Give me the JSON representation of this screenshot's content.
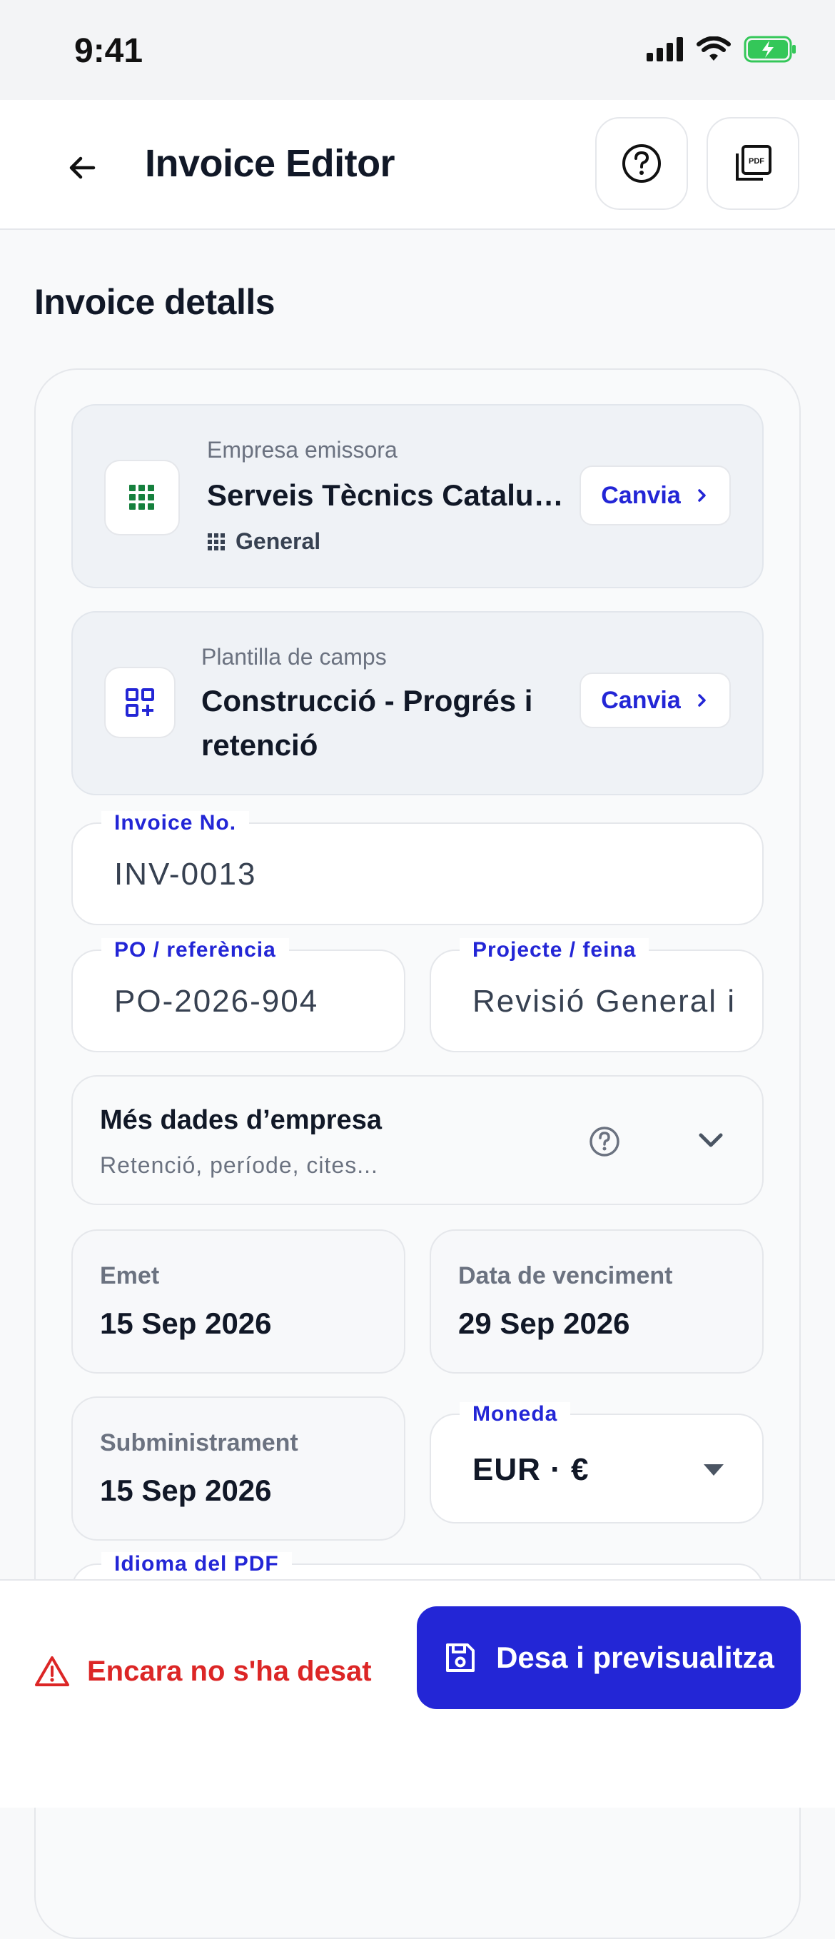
{
  "status_bar": {
    "time": "9:41"
  },
  "app_bar": {
    "title": "Invoice Editor"
  },
  "section": {
    "title": "Invoice detalls"
  },
  "company_picker": {
    "kicker": "Empresa emissora",
    "value": "Serveis Tècnics Catalunya",
    "sub": "General",
    "button_label": "Canvia"
  },
  "template_picker": {
    "kicker": "Plantilla de camps",
    "value_line1": "Construcció - Progrés i",
    "value_line2": "retenció",
    "button_label": "Canvia"
  },
  "fields": {
    "invoice_no": {
      "label": "Invoice No.",
      "value": "INV-0013"
    },
    "po_ref": {
      "label": "PO / referència",
      "value": "PO-2026-904"
    },
    "project": {
      "label": "Projecte / feina",
      "value": "Revisió General i"
    },
    "currency": {
      "label": "Moneda",
      "value": "EUR · €"
    },
    "pdf_language": {
      "label": "Idioma del PDF"
    }
  },
  "more_company": {
    "title": "Més dades d’empresa",
    "subtitle": "Retenció, període, cites..."
  },
  "dates": {
    "issued": {
      "label": "Emet",
      "value": "15 Sep 2026"
    },
    "due": {
      "label": "Data de venciment",
      "value": "29 Sep 2026"
    },
    "supply": {
      "label": "Subministrament",
      "value": "15 Sep 2026"
    }
  },
  "bottom": {
    "unsaved_text": "Encara no s'ha desat",
    "save_label": "Desa i previsualitza"
  },
  "colors": {
    "accent": "#2326d6",
    "danger": "#dc2626",
    "green_icon": "#15803d",
    "battery": "#34c759"
  }
}
